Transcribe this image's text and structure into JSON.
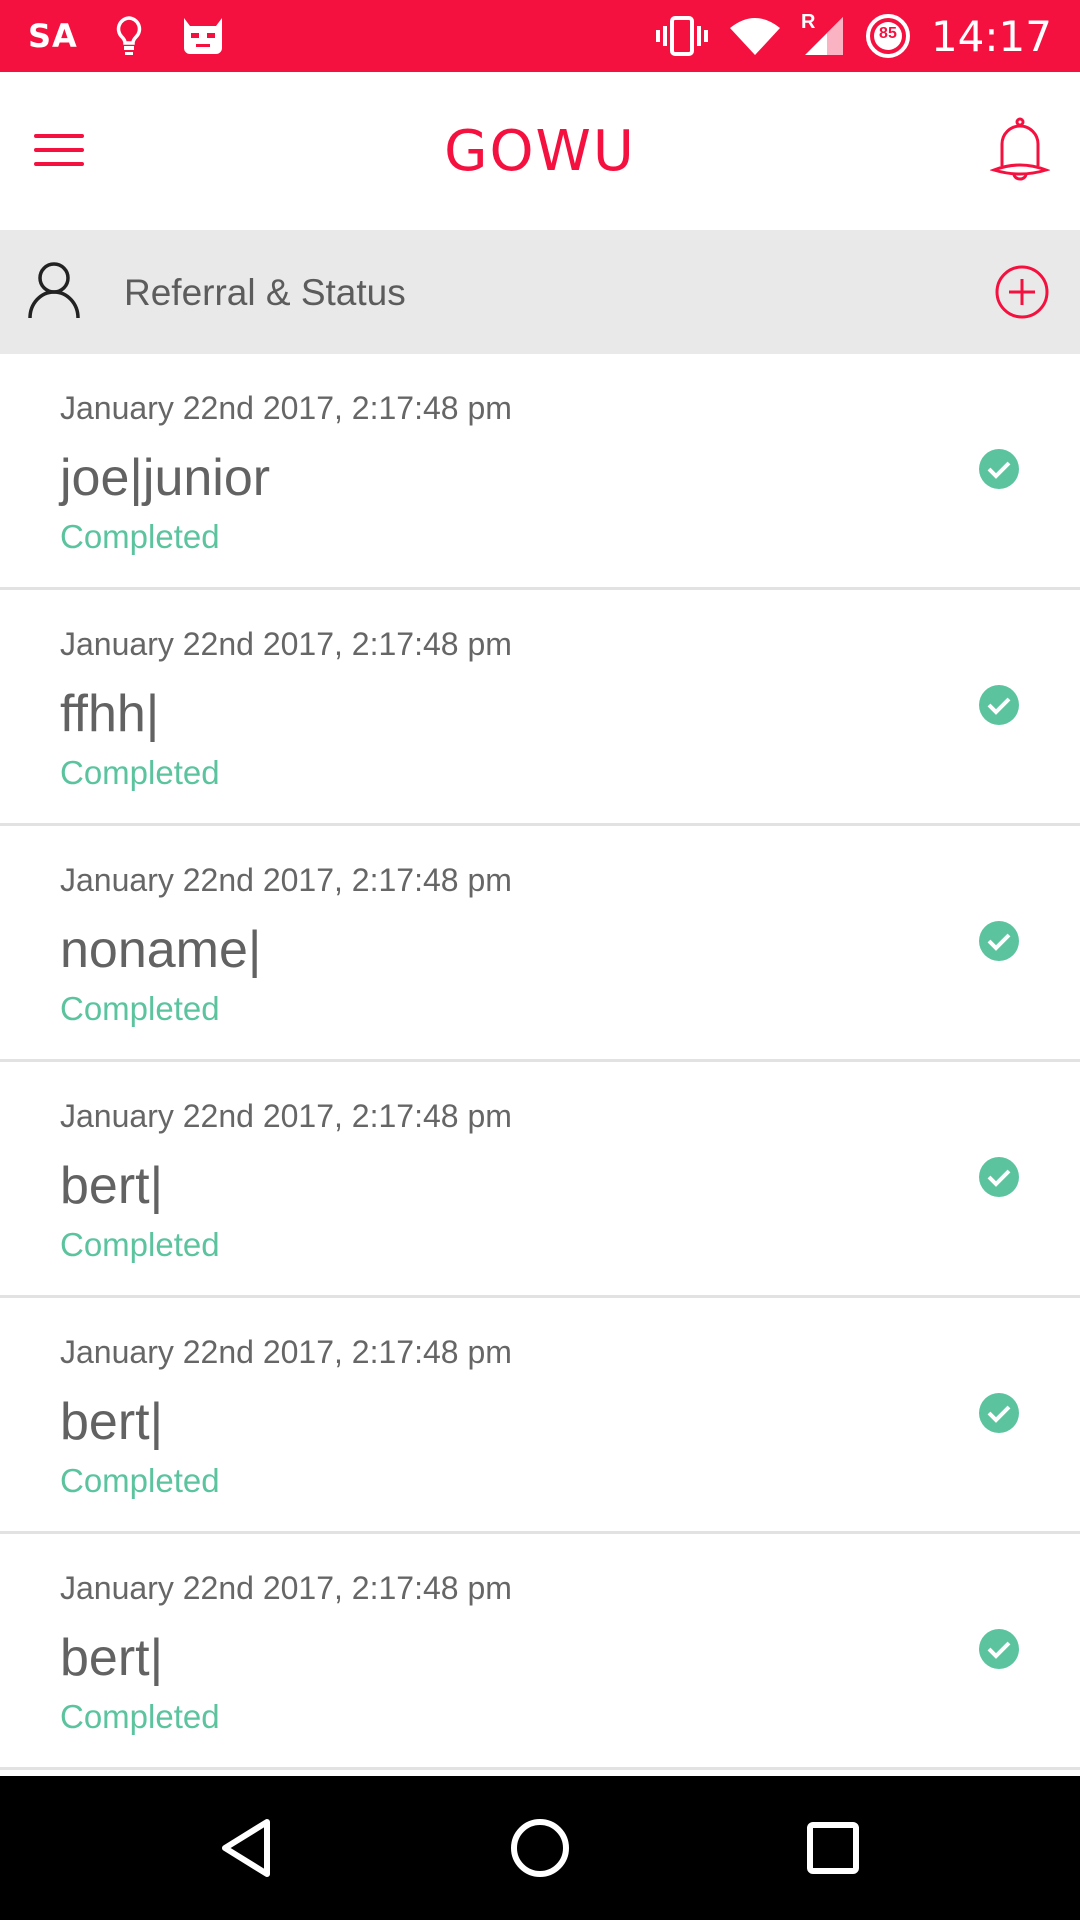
{
  "status_bar": {
    "carrier": "SA",
    "battery_level": "85",
    "time": "14:17",
    "roaming_indicator": "R",
    "icons": [
      "lightbulb-icon",
      "cyanogen-icon",
      "vibrate-icon",
      "wifi-icon",
      "signal-icon",
      "battery-icon"
    ]
  },
  "app_bar": {
    "title": "GOWU",
    "icons": [
      "hamburger-menu-icon",
      "bell-icon"
    ]
  },
  "section": {
    "title": "Referral & Status",
    "icons": [
      "person-icon",
      "add-circle-icon"
    ]
  },
  "referrals": [
    {
      "date": "January 22nd 2017, 2:17:48 pm",
      "name": "joe|junior",
      "status": "Completed"
    },
    {
      "date": "January 22nd 2017, 2:17:48 pm",
      "name": "ffhh|",
      "status": "Completed"
    },
    {
      "date": "January 22nd 2017, 2:17:48 pm",
      "name": "noname|",
      "status": "Completed"
    },
    {
      "date": "January 22nd 2017, 2:17:48 pm",
      "name": "bert|",
      "status": "Completed"
    },
    {
      "date": "January 22nd 2017, 2:17:48 pm",
      "name": "bert|",
      "status": "Completed"
    },
    {
      "date": "January 22nd 2017, 2:17:48 pm",
      "name": "bert|",
      "status": "Completed"
    }
  ],
  "nav_bar": {
    "icons": [
      "back-icon",
      "home-icon",
      "recents-icon"
    ]
  },
  "colors": {
    "accent": "#f5113f",
    "completed": "#5bc49f",
    "header_bg": "#e9e9e9"
  }
}
